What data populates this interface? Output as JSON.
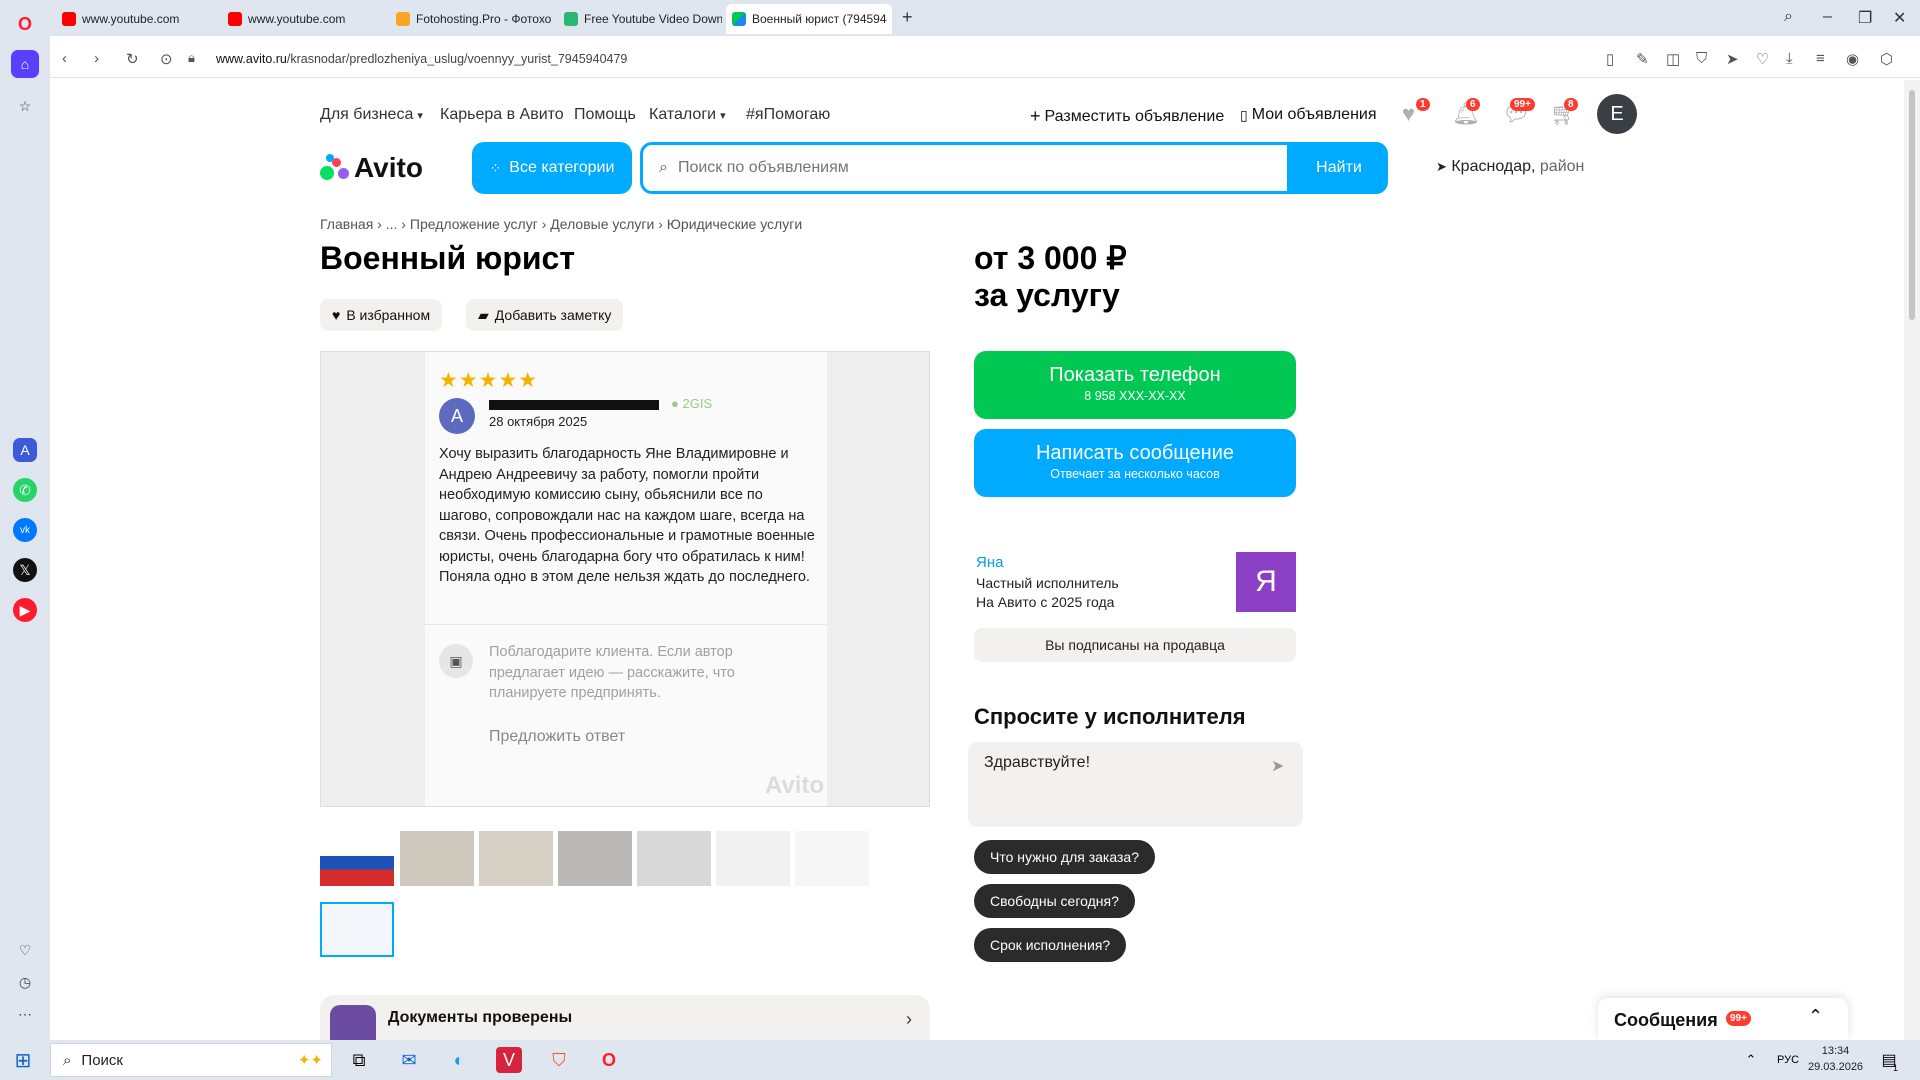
{
  "browser": {
    "tabs": [
      {
        "label": "www.youtube.com"
      },
      {
        "label": "www.youtube.com"
      },
      {
        "label": "Fotohosting.Pro - Фотохо"
      },
      {
        "label": "Free Youtube Video Down"
      },
      {
        "label": "Военный юрист (794594"
      }
    ],
    "url_host": "www.avito.ru",
    "url_path": "/krasnodar/predlozheniya_uslug/voennyy_yurist_7945940479"
  },
  "header": {
    "nav": [
      "Для бизнеса",
      "Карьера в Авито",
      "Помощь",
      "Каталоги",
      "#яПомогаю"
    ],
    "post_ad": "Разместить объявление",
    "my_ads": "Мои объявления",
    "badges": {
      "favorites": "1",
      "notifications": "6",
      "messages": "99+",
      "cart": "8"
    },
    "avatar_letter": "E",
    "logo_text": "Avito",
    "all_categories": "Все категории",
    "search_placeholder": "Поиск по объявлениям",
    "find_button": "Найти",
    "location_city": "Краснодар,",
    "location_sub": "район"
  },
  "breadcrumbs": [
    "Главная",
    "...",
    "Предложение услуг",
    "Деловые услуги",
    "Юридические услуги"
  ],
  "listing": {
    "title": "Военный юрист",
    "favorite_button": "В избранном",
    "note_button": "Добавить заметку",
    "price_line1": "от 3 000 ₽",
    "price_line2": "за услугу",
    "show_phone": "Показать телефон",
    "phone_masked": "8 958 XXX-XX-XX",
    "write_message": "Написать сообщение",
    "reply_time": "Отвечает за несколько часов"
  },
  "review_image": {
    "stars": "★★★★★",
    "avatar_letter": "А",
    "source": "2GIS",
    "date": "28 октября 2025",
    "text": "Хочу выразить благодарность Яне Владимировне и Андрею Андреевичу за работу, помогли пройти необходимую комиссию сыну, обьяснили все по шагово, сопровождали нас на каждом шаге, всегда на связи. Очень профессиональные и грамотные военные юристы, очень благодарна богу что обратилась к ним! Поняла одно в этом деле нельзя ждать до последнего.",
    "hint": "Поблагодарите клиента. Если автор предлагает идею — расскажите, что планируете предпринять.",
    "suggest": "Предложить ответ",
    "watermark": "Avito"
  },
  "docs_banner": {
    "title": "Документы проверены"
  },
  "seller": {
    "name": "Яна",
    "type": "Частный исполнитель",
    "since": "На Авито с 2025 года",
    "avatar_letter": "Я",
    "subscribed": "Вы подписаны на продавца"
  },
  "ask": {
    "title": "Спросите у исполнителя",
    "message_value": "Здравствуйте!",
    "chips": [
      "Что нужно для заказа?",
      "Свободны сегодня?",
      "Срок исполнения?"
    ]
  },
  "messages_panel": {
    "title": "Сообщения",
    "badge": "99+"
  },
  "taskbar": {
    "search_label": "Поиск",
    "lang": "РУС",
    "time": "13:34",
    "date": "29.03.2026",
    "notif_count": "1"
  },
  "colors": {
    "accent": "#00aaff",
    "green": "#00c853",
    "seller_avatar": "#8a3fc4",
    "badge": "#ff3b30"
  }
}
